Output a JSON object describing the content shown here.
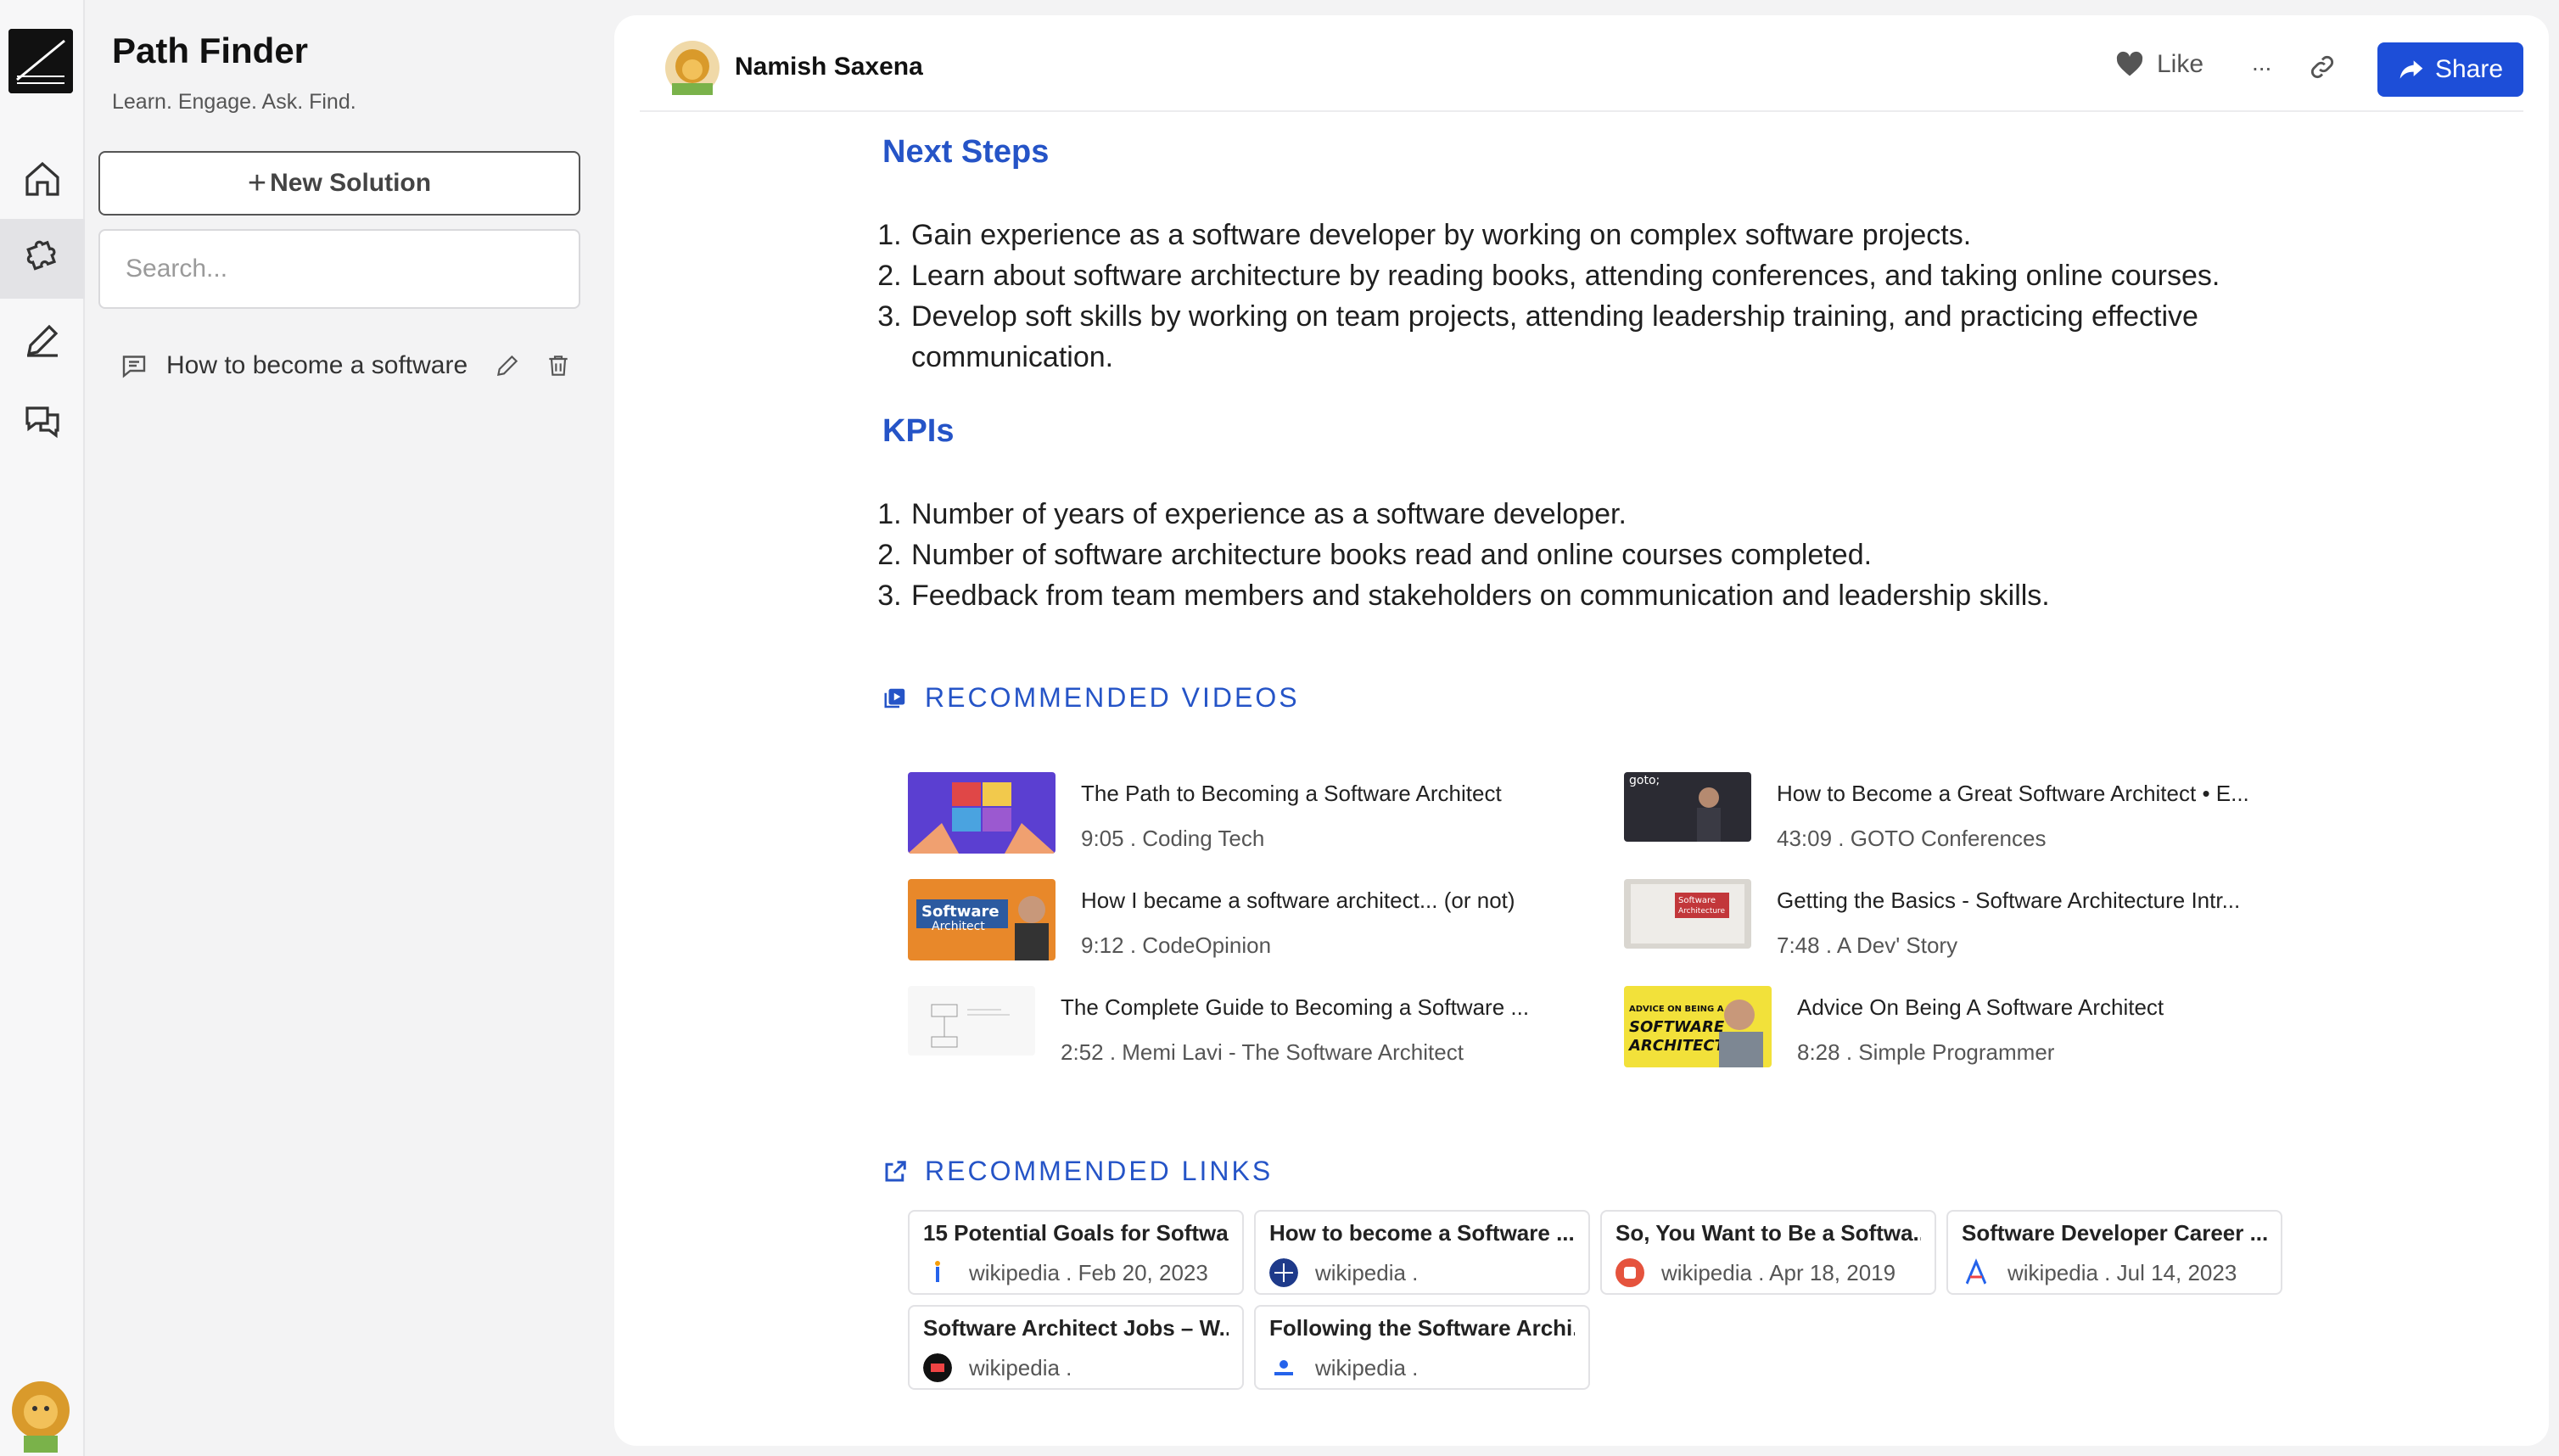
{
  "app": {
    "title": "Path Finder",
    "tagline": "Learn. Engage. Ask. Find.",
    "new_solution_label": "New Solution",
    "search_placeholder": "Search...",
    "threads": [
      {
        "label": "How to become a software"
      }
    ]
  },
  "header": {
    "user_name": "Namish Saxena",
    "like_label": "Like",
    "more_label": "...",
    "share_label": "Share"
  },
  "sections": {
    "next_steps": {
      "heading": "Next Steps",
      "items": [
        "Gain experience as a software developer by working on complex software projects.",
        "Learn about software architecture by reading books, attending conferences, and taking online courses.",
        "Develop soft skills by working on team projects, attending leadership training, and practicing effective communication."
      ]
    },
    "kpis": {
      "heading": "KPIs",
      "items": [
        "Number of years of experience as a software developer.",
        "Number of software architecture books read and online courses completed.",
        "Feedback from team members and stakeholders on communication and leadership skills."
      ]
    },
    "videos_heading": "RECOMMENDED VIDEOS",
    "links_heading": "RECOMMENDED LINKS"
  },
  "videos": [
    {
      "title": "The Path to Becoming a Software Architect",
      "meta": "9:05 . Coding Tech"
    },
    {
      "title": "How to Become a Great Software Architect • E...",
      "meta": "43:09 . GOTO Conferences"
    },
    {
      "title": "How I became a software architect... (or not)",
      "meta": "9:12 . CodeOpinion"
    },
    {
      "title": "Getting the Basics - Software Architecture Intr...",
      "meta": "7:48 . A Dev' Story"
    },
    {
      "title": "The Complete Guide to Becoming a Software ...",
      "meta": "2:52 . Memi Lavi - The Software Architect"
    },
    {
      "title": "Advice On Being A Software Architect",
      "meta": "8:28 . Simple Programmer"
    }
  ],
  "thumb_text": {
    "goto": "goto;",
    "sa_1": "Software",
    "sa_2": "Architect",
    "basics_1": "Software",
    "basics_2": "Architecture",
    "advice_1": "ADVICE ON BEING A",
    "advice_2": "SOFTWARE",
    "advice_3": "ARCHITECT"
  },
  "links": [
    {
      "title": "15 Potential Goals for Softwa...",
      "meta": "wikipedia . Feb 20, 2023",
      "color": "#ffffff"
    },
    {
      "title": "How to become a Software ...",
      "meta": "wikipedia .",
      "color": "#1e3a8a"
    },
    {
      "title": "So, You Want to Be a Softwa...",
      "meta": "wikipedia . Apr 18, 2019",
      "color": "#e5533d"
    },
    {
      "title": "Software Developer Career ...",
      "meta": "wikipedia . Jul 14, 2023",
      "color": "#ffffff"
    },
    {
      "title": "Software Architect Jobs – W...",
      "meta": "wikipedia .",
      "color": "#111111"
    },
    {
      "title": "Following the Software Archi...",
      "meta": "wikipedia .",
      "color": "#ffffff"
    }
  ],
  "colors": {
    "accent": "#2554c7",
    "share": "#1d4ed8"
  }
}
